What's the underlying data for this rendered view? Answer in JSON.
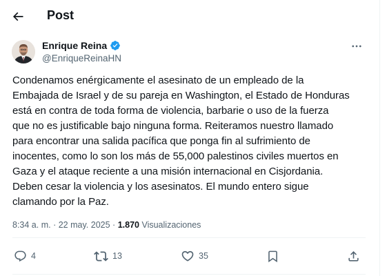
{
  "header": {
    "title": "Post"
  },
  "author": {
    "name": "Enrique Reina",
    "handle": "@EnriqueReinaHN"
  },
  "post": {
    "text": "Condenamos enérgicamente el asesinato de un empleado de la\nEmbajada de Israel y de su pareja en Washington, el Estado de Honduras\nestá en contra de toda forma de violencia,  barbarie  o uso de la fuerza\nque no es justificable bajo ninguna forma. Reiteramos nuestro llamado\npara encontrar una salida pacífica que ponga fin al sufrimiento de\ninocentes, como lo son los más de 55,000 palestinos civiles muertos en\nGaza y el ataque reciente a una misión internacional en Cisjordania.\nDeben cesar la violencia y los asesinatos. El mundo entero sigue\nclamando por la Paz.",
    "time": "8:34 a. m.",
    "separator": "·",
    "date": "22 may. 2025",
    "views_count": "1.870",
    "views_label": "Visualizaciones"
  },
  "actions": {
    "replies": "4",
    "reposts": "13",
    "likes": "35"
  },
  "colors": {
    "text": "#0f1419",
    "secondary": "#536471",
    "verified": "#1d9bf0",
    "divider": "#eff3f4"
  },
  "icons": {
    "back": "arrow-left-icon",
    "verified": "verified-badge-icon",
    "more": "more-horizontal-icon",
    "reply": "reply-icon",
    "repost": "repost-icon",
    "like": "heart-icon",
    "share": "share-icon"
  }
}
